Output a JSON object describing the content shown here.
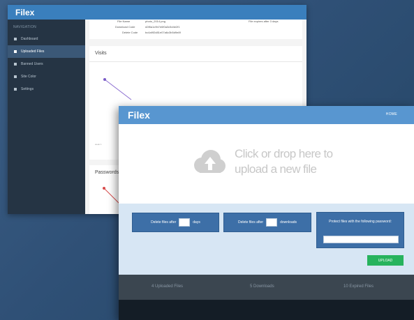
{
  "admin": {
    "logo": "Filex",
    "sidebar_heading": "NAVIGATION",
    "sidebar_items": [
      {
        "label": "Dashboard",
        "icon": "home-icon"
      },
      {
        "label": "Uploaded Files",
        "icon": "files-icon",
        "active": true
      },
      {
        "label": "Banned Users",
        "icon": "ban-icon"
      },
      {
        "label": "Site Color",
        "icon": "brush-icon"
      },
      {
        "label": "Settings",
        "icon": "gear-icon"
      }
    ],
    "info": {
      "top_label": "File Name",
      "top_value": "photo_2014.png",
      "download_label": "Download Code",
      "download_value": "d2f8a1c9b7e6f0a3c5d4e2f1",
      "delete_label": "Delete Code",
      "delete_value": "bc4a9f2d81e07a6c3b5d9e8f",
      "right_text": "File expires after 3 days"
    },
    "visits_title": "Visits",
    "visits_axis_label": "week 1",
    "passwords_title": "Passwords"
  },
  "upload": {
    "logo": "Filex",
    "nav_home": "HOME",
    "drop_text": "Click or drop here to upload a new file",
    "delete_days_before": "Delete files after",
    "delete_days_after": "days",
    "delete_downloads_before": "Delete files after",
    "delete_downloads_after": "downloads",
    "protect_label": "Protect files with the following password:",
    "upload_button": "UPLOAD",
    "stats": {
      "uploaded": "4 Uploaded Files",
      "downloads": "5 Downloads",
      "expired": "10 Expired Files"
    }
  },
  "colors": {
    "header_blue": "#5896d0",
    "admin_header": "#3a7fbd",
    "option_blue": "#3d6fa7",
    "upload_green": "#27b35d",
    "sidebar": "#253444"
  }
}
